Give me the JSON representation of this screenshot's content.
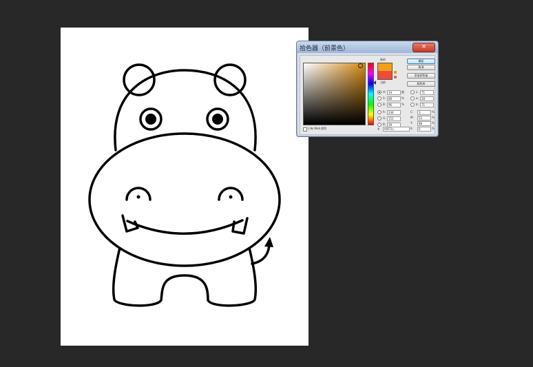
{
  "app": {
    "background_color": "#282828",
    "canvas_color": "#ffffff"
  },
  "dialog": {
    "title": "拾色器（前景色）",
    "close_icon": "×",
    "new_label": "新的",
    "current_label": "当前",
    "buttons": {
      "ok": "确定",
      "cancel": "取消",
      "add_swatch": "添加到色板",
      "color_libraries": "颜色库"
    },
    "hsb": [
      {
        "label": "H:",
        "value": "34",
        "unit": "度"
      },
      {
        "label": "S:",
        "value": "88",
        "unit": "%"
      },
      {
        "label": "B:",
        "value": "96",
        "unit": "%"
      }
    ],
    "rgb": [
      {
        "label": "R:",
        "value": "244",
        "unit": ""
      },
      {
        "label": "G:",
        "value": "151",
        "unit": ""
      },
      {
        "label": "B:",
        "value": "28",
        "unit": ""
      }
    ],
    "lab": [
      {
        "label": "L:",
        "value": "71",
        "unit": ""
      },
      {
        "label": "a:",
        "value": "28",
        "unit": ""
      },
      {
        "label": "b:",
        "value": "71",
        "unit": ""
      }
    ],
    "cmyk": [
      {
        "label": "C:",
        "value": "3",
        "unit": "%"
      },
      {
        "label": "M:",
        "value": "52",
        "unit": "%"
      },
      {
        "label": "Y:",
        "value": "88",
        "unit": "%"
      },
      {
        "label": "K:",
        "value": "0",
        "unit": "%"
      }
    ],
    "web_only_label": "只有 Web 颜色",
    "hex_label": "#",
    "hex_value": "f4971c",
    "new_color": "#f2a01a",
    "current_color": "#f04a3a"
  }
}
